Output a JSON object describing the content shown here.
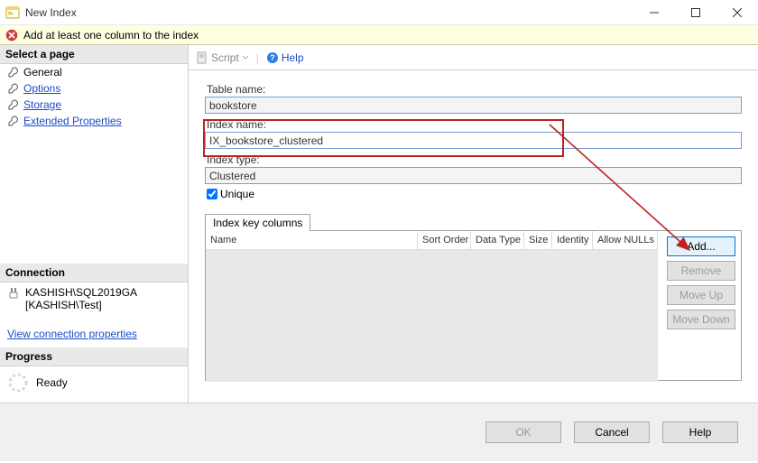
{
  "window": {
    "title": "New Index",
    "minimize": "—",
    "maximize": "☐",
    "close": "✕"
  },
  "warning": {
    "text": "Add at least one column to the index"
  },
  "left": {
    "select_page": "Select a page",
    "pages": {
      "general": "General",
      "options": "Options",
      "storage": "Storage",
      "extprops": "Extended Properties"
    },
    "connection_header": "Connection",
    "server": "KASHISH\\SQL2019GA",
    "context": "[KASHISH\\Test]",
    "view_props": "View connection properties",
    "progress_header": "Progress",
    "ready": "Ready"
  },
  "scriptbar": {
    "script": "Script",
    "help": "Help",
    "separator": "|"
  },
  "form": {
    "table_name_label": "Table name:",
    "table_name_value": "bookstore",
    "index_name_label": "Index name:",
    "index_name_value": "IX_bookstore_clustered",
    "index_type_label": "Index type:",
    "index_type_value": "Clustered",
    "unique_label": "Unique"
  },
  "tabs": {
    "key_columns": "Index key columns"
  },
  "grid": {
    "columns": {
      "name": "Name",
      "sort": "Sort Order",
      "dtype": "Data Type",
      "size": "Size",
      "identity": "Identity",
      "nulls": "Allow NULLs"
    }
  },
  "grid_buttons": {
    "add": "Add...",
    "remove": "Remove",
    "move_up": "Move Up",
    "move_down": "Move Down"
  },
  "dialog_buttons": {
    "ok": "OK",
    "cancel": "Cancel",
    "help": "Help"
  }
}
